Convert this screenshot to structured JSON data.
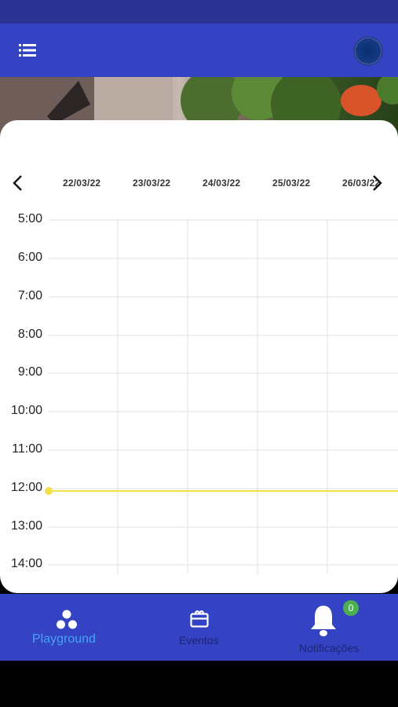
{
  "dates": [
    "22/03/22",
    "23/03/22",
    "24/03/22",
    "25/03/22",
    "26/03/22"
  ],
  "times": [
    "5:00",
    "6:00",
    "7:00",
    "8:00",
    "9:00",
    "10:00",
    "11:00",
    "12:00",
    "13:00",
    "14:00"
  ],
  "current_time_marker": "12:00",
  "bottom_nav": {
    "playground": "Playground",
    "eventos": "Eventos",
    "notificacoes": "Notificações",
    "badge_count": "0"
  },
  "icons": {
    "menu": "menu-icon",
    "avatar": "avatar",
    "prev": "chevron-left-icon",
    "next": "chevron-right-icon",
    "playground": "dots-icon",
    "eventos": "calendar-icon",
    "notificacoes": "bell-icon"
  },
  "colors": {
    "primary": "#3443c4",
    "status_bar": "#2a3394",
    "active_label": "#42a5f5",
    "inactive_label": "#1b2470",
    "now_line": "#f2e04a",
    "badge": "#4caf50"
  }
}
